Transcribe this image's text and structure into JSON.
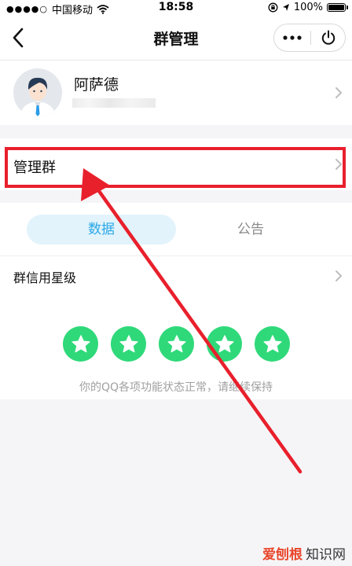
{
  "status_bar": {
    "carrier": "中国移动",
    "time": "18:58",
    "battery": "100%"
  },
  "nav": {
    "title": "群管理"
  },
  "profile": {
    "name": "阿萨德"
  },
  "manage_row": {
    "label": "管理群"
  },
  "tabs": [
    {
      "label": "数据",
      "active": true
    },
    {
      "label": "公告",
      "active": false
    }
  ],
  "credit": {
    "label": "群信用星级",
    "rating": 5,
    "max_rating": 5,
    "status_text": "你的QQ各项功能状态正常，请继续保持"
  },
  "watermark": {
    "brand": "爱刨根",
    "site": "知识网"
  },
  "colors": {
    "highlight": "#e8202c",
    "tab_active_bg": "#e2f3fb",
    "tab_active_text": "#2aa8e8",
    "star": "#2fd97a"
  }
}
